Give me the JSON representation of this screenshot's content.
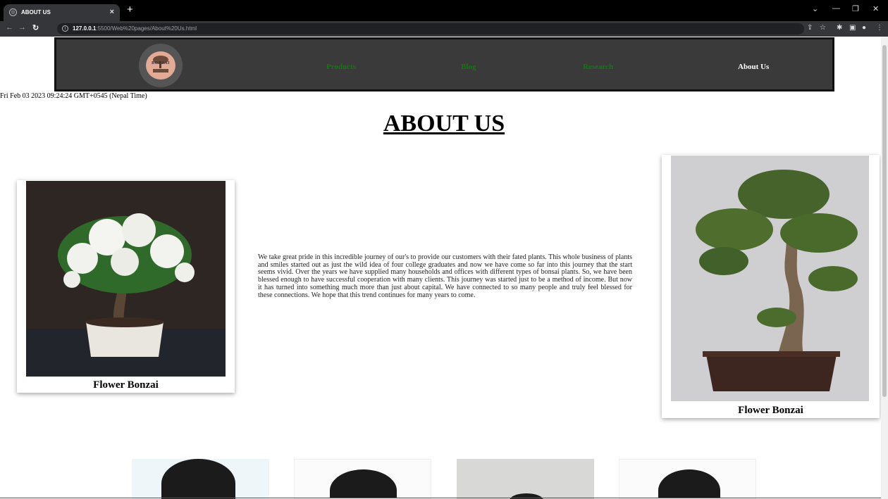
{
  "browser": {
    "tab_title": "ABOUT US",
    "tab_close": "×",
    "new_tab": "+",
    "url_host": "127.0.0.1",
    "url_rest": ":5500/Web%20pages/About%20Us.html"
  },
  "site": {
    "logo_text": "BONSAI",
    "nav": {
      "products": "Products",
      "blog": "Blog",
      "research": "Research",
      "about": "About Us"
    },
    "datetime": "Fri Feb 03 2023 09:24:24 GMT+0545 (Nepal Time)",
    "heading": "ABOUT US",
    "left_caption": "Flower Bonzai",
    "right_caption": "Flower Bonzai",
    "about_text": "We take great pride in this incredible journey of our's to provide our customers with their fated plants. This whole business of plants and smiles started out as just the wild idea of four college graduates and now we have come so far into this journey that the start seems vivid. Over the years we have supplied many households and offices with different types of bonsai plants. So, we have been blessed enough to have successful cooperation with many clients. This journey was started just to be a method of income. But now it has turned into something much more than just about capital. We have connected to so many people and truly feel blessed for these connections. We hope that this trend continues for many years to come."
  },
  "colors": {
    "nav_bg": "#3a3a3a",
    "nav_link": "#0e7a0e",
    "nav_active": "#ffffff"
  }
}
